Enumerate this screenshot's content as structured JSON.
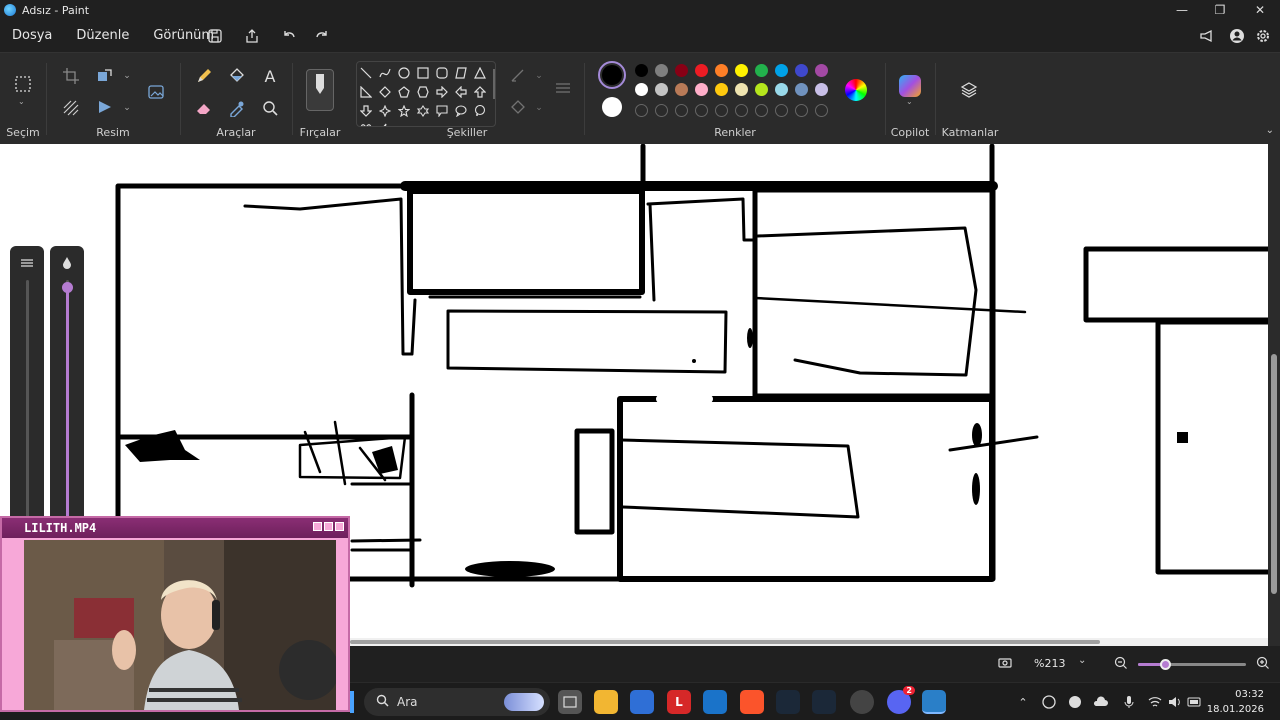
{
  "window": {
    "title": "Adsız - Paint"
  },
  "menu": {
    "items": [
      "Dosya",
      "Düzenle",
      "Görünüm"
    ]
  },
  "ribbon": {
    "groups": {
      "selection": "Seçim",
      "image": "Resim",
      "tools": "Araçlar",
      "brushes": "Fırçalar",
      "shapes": "Şekiller",
      "colors": "Renkler",
      "copilot": "Copilot",
      "layers": "Katmanlar"
    },
    "palette_row1": [
      "#000000",
      "#7f7f7f",
      "#880015",
      "#ed1c24",
      "#ff7f27",
      "#fff200",
      "#22b14c",
      "#00a2e8",
      "#3f48cc",
      "#a349a4"
    ],
    "palette_row2": [
      "#ffffff",
      "#c3c3c3",
      "#b97a57",
      "#ffaec9",
      "#ffc90e",
      "#efe4b0",
      "#b5e61d",
      "#99d9ea",
      "#7092be",
      "#c8bfe7"
    ],
    "primary_color": "#000000",
    "secondary_color": "#ffffff"
  },
  "status": {
    "zoom": "%213",
    "zoom_level": 0.25
  },
  "webcam": {
    "title": "LILITH.MP4"
  },
  "taskbar": {
    "search_placeholder": "Ara",
    "time": "03:32",
    "date": "18.01.2026",
    "discord_badge": "2"
  }
}
